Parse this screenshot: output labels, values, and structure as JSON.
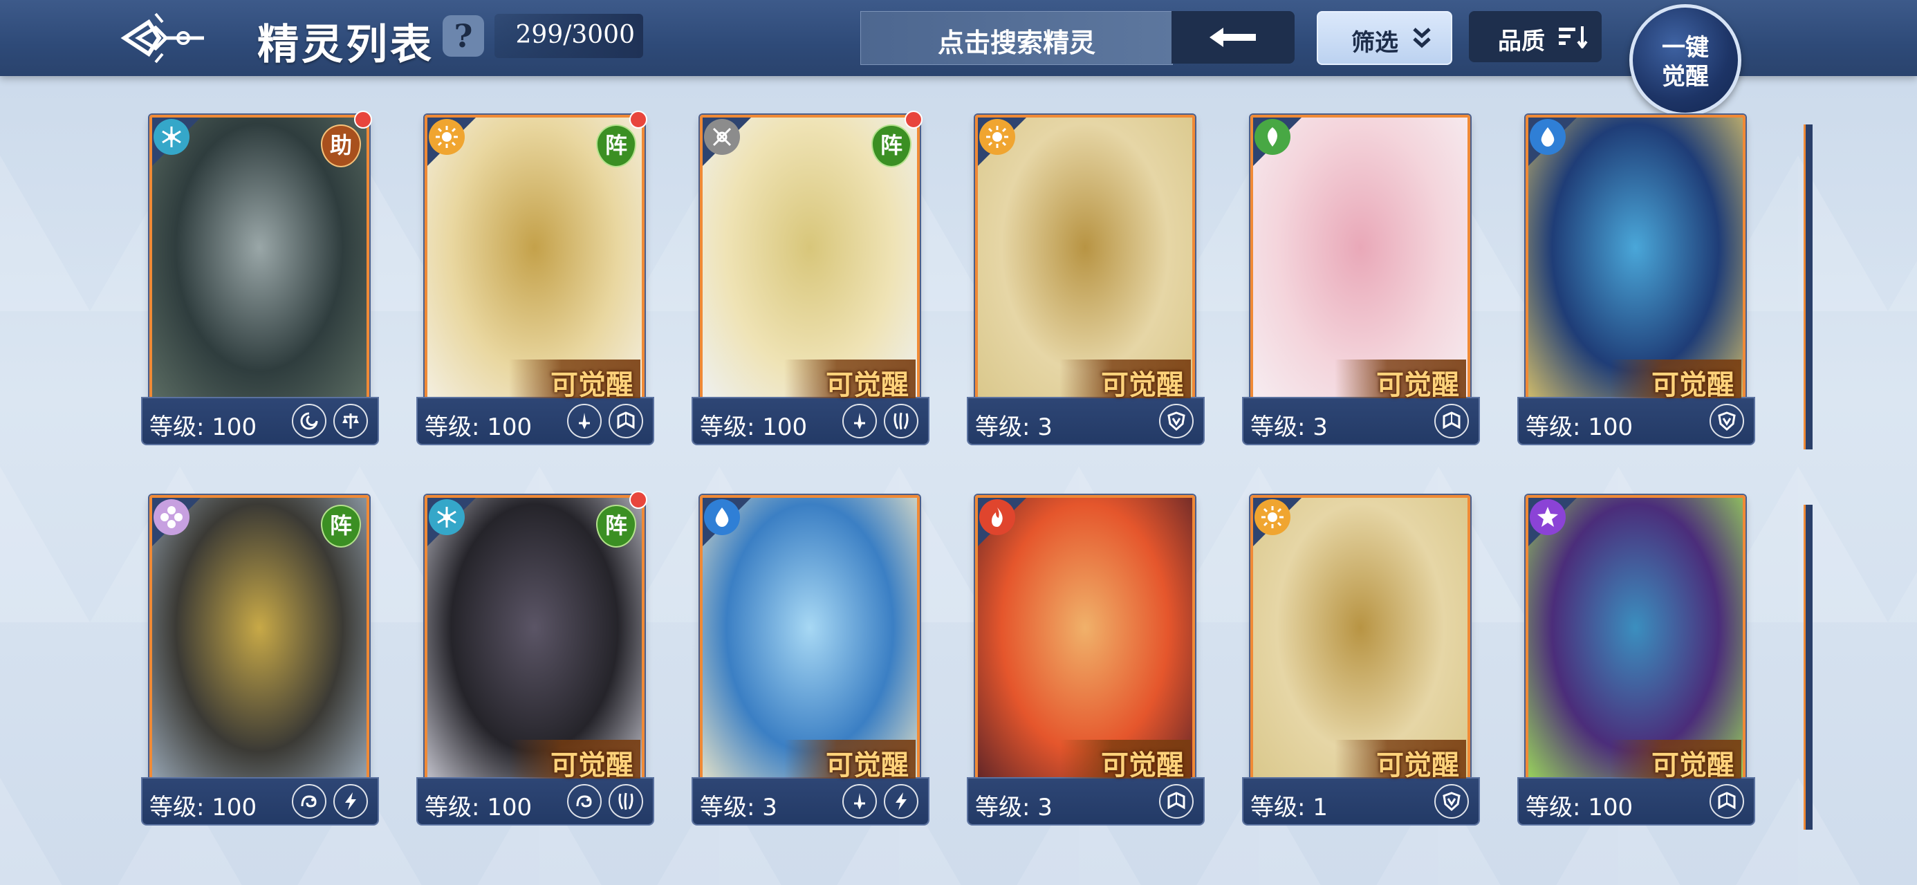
{
  "header": {
    "title": "精灵列表",
    "help": "?",
    "count": "299/3000",
    "search_placeholder": "点击搜索精灵",
    "filter_label": "筛选",
    "quality_label": "品质",
    "awaken_line1": "一键",
    "awaken_line2": "觉醒"
  },
  "colors": {
    "accent_orange": "#f08a36",
    "header_blue": "#2e4a78",
    "awakenable_gold": "#ffd27a"
  },
  "rows": [
    {
      "cards": [
        {
          "element": "star-snowflake",
          "role": "助",
          "new": true,
          "awakenable": "",
          "level": "等级: 100",
          "badges": [
            "swirl-icon",
            "scale-icon"
          ],
          "art": [
            "#2f3d3e",
            "#9aa7a8",
            "#5d6e64"
          ]
        },
        {
          "element": "sun",
          "role": "阵",
          "new": true,
          "awakenable": "可觉醒",
          "level": "等级: 100",
          "badges": [
            "sword-icon",
            "book-icon"
          ],
          "art": [
            "#e9d7a0",
            "#c4a14a",
            "#f4f0e4"
          ]
        },
        {
          "element": "cross-arrows",
          "role": "阵",
          "new": true,
          "awakenable": "可觉醒",
          "level": "等级: 100",
          "badges": [
            "sword-icon",
            "claw-icon"
          ],
          "art": [
            "#efe3b5",
            "#d8c67a",
            "#eef1f3"
          ]
        },
        {
          "element": "sun",
          "role": "",
          "new": false,
          "awakenable": "可觉醒",
          "level": "等级: 3",
          "badges": [
            "shield-icon"
          ],
          "art": [
            "#e6d6a6",
            "#b89443",
            "#d9c78a"
          ]
        },
        {
          "element": "leaf",
          "role": "",
          "new": false,
          "awakenable": "可觉醒",
          "level": "等级: 3",
          "badges": [
            "book-icon"
          ],
          "art": [
            "#f4d5dc",
            "#e9a8b8",
            "#f6eef2"
          ]
        },
        {
          "element": "water",
          "role": "",
          "new": false,
          "awakenable": "可觉醒",
          "level": "等级: 100",
          "badges": [
            "shield-icon"
          ],
          "art": [
            "#1f3d77",
            "#4aa7d9",
            "#d9c26a"
          ]
        }
      ]
    },
    {
      "cards": [
        {
          "element": "flower-rainbow",
          "role": "阵",
          "new": false,
          "awakenable": "",
          "level": "等级: 100",
          "badges": [
            "dragon-icon",
            "lightning-icon"
          ],
          "art": [
            "#3b3a35",
            "#c8a947",
            "#9aa9b8"
          ]
        },
        {
          "element": "star-snowflake",
          "role": "阵",
          "new": true,
          "awakenable": "可觉醒",
          "level": "等级: 100",
          "badges": [
            "dragon-icon",
            "claw-icon"
          ],
          "art": [
            "#25242a",
            "#5b5566",
            "#c9c9d3"
          ]
        },
        {
          "element": "water",
          "role": "",
          "new": false,
          "awakenable": "可觉醒",
          "level": "等级: 3",
          "badges": [
            "sword-icon",
            "lightning-icon"
          ],
          "art": [
            "#3b7fc4",
            "#a7d8f4",
            "#e9e4c8"
          ]
        },
        {
          "element": "fire",
          "role": "",
          "new": false,
          "awakenable": "可觉醒",
          "level": "等级: 3",
          "badges": [
            "book-icon"
          ],
          "art": [
            "#e5562c",
            "#f0b16a",
            "#5c2428"
          ]
        },
        {
          "element": "sun",
          "role": "",
          "new": false,
          "awakenable": "可觉醒",
          "level": "等级: 1",
          "badges": [
            "shield-icon"
          ],
          "art": [
            "#e6d6a6",
            "#b89443",
            "#d9c78a"
          ]
        },
        {
          "element": "poison-star",
          "role": "",
          "new": false,
          "awakenable": "可觉醒",
          "level": "等级: 100",
          "badges": [
            "book-icon"
          ],
          "art": [
            "#4b2d7a",
            "#3b8fbf",
            "#9ddc5a"
          ]
        }
      ]
    }
  ]
}
